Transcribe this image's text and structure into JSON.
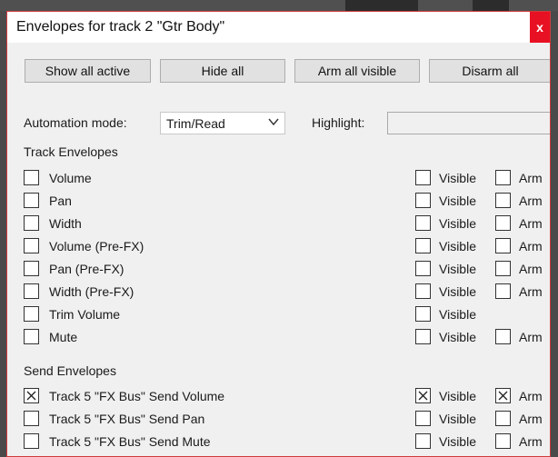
{
  "window": {
    "title": "Envelopes for track 2 \"Gtr Body\"",
    "close_glyph": "x"
  },
  "toolbar": {
    "show_all_active": "Show all active",
    "hide_all": "Hide all",
    "arm_all_visible": "Arm all visible",
    "disarm_all": "Disarm all"
  },
  "automation": {
    "label": "Automation mode:",
    "value": "Trim/Read",
    "highlight_label": "Highlight:",
    "highlight_value": ""
  },
  "track_envelopes": {
    "heading": "Track Envelopes",
    "items": [
      {
        "label": "Volume",
        "checked": false,
        "visible_label": "Visible",
        "visible_checked": false,
        "arm_label": "Arm",
        "arm_checked": false
      },
      {
        "label": "Pan",
        "checked": false,
        "visible_label": "Visible",
        "visible_checked": false,
        "arm_label": "Arm",
        "arm_checked": false
      },
      {
        "label": "Width",
        "checked": false,
        "visible_label": "Visible",
        "visible_checked": false,
        "arm_label": "Arm",
        "arm_checked": false
      },
      {
        "label": "Volume (Pre-FX)",
        "checked": false,
        "visible_label": "Visible",
        "visible_checked": false,
        "arm_label": "Arm",
        "arm_checked": false
      },
      {
        "label": "Pan (Pre-FX)",
        "checked": false,
        "visible_label": "Visible",
        "visible_checked": false,
        "arm_label": "Arm",
        "arm_checked": false
      },
      {
        "label": "Width (Pre-FX)",
        "checked": false,
        "visible_label": "Visible",
        "visible_checked": false,
        "arm_label": "Arm",
        "arm_checked": false
      },
      {
        "label": "Trim Volume",
        "checked": false,
        "visible_label": "Visible",
        "visible_checked": false,
        "arm_label": null,
        "arm_checked": false
      },
      {
        "label": "Mute",
        "checked": false,
        "visible_label": "Visible",
        "visible_checked": false,
        "arm_label": "Arm",
        "arm_checked": false
      }
    ]
  },
  "send_envelopes": {
    "heading": "Send Envelopes",
    "items": [
      {
        "label": "Track 5 \"FX Bus\" Send Volume",
        "checked": true,
        "visible_label": "Visible",
        "visible_checked": true,
        "arm_label": "Arm",
        "arm_checked": true
      },
      {
        "label": "Track 5 \"FX Bus\" Send Pan",
        "checked": false,
        "visible_label": "Visible",
        "visible_checked": false,
        "arm_label": "Arm",
        "arm_checked": false
      },
      {
        "label": "Track 5 \"FX Bus\" Send Mute",
        "checked": false,
        "visible_label": "Visible",
        "visible_checked": false,
        "arm_label": "Arm",
        "arm_checked": false
      }
    ]
  },
  "colors": {
    "dialog_bg": "#f0f0f0",
    "close_button": "#e81123",
    "button_bg": "#e1e1e1"
  }
}
